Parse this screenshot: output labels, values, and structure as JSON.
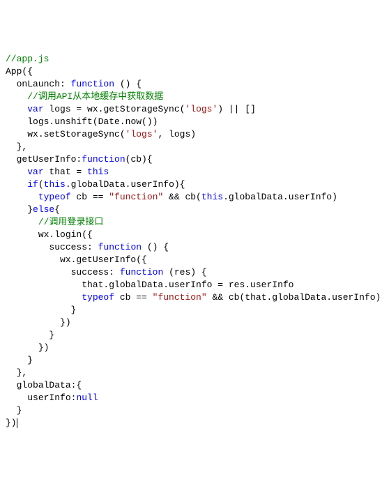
{
  "code": {
    "lines": [
      {
        "indent": 0,
        "tokens": [
          {
            "t": "//app.js",
            "c": "cmt"
          }
        ]
      },
      {
        "indent": 0,
        "tokens": [
          {
            "t": "App({",
            "c": ""
          }
        ]
      },
      {
        "indent": 1,
        "tokens": [
          {
            "t": "onLaunch: ",
            "c": ""
          },
          {
            "t": "function",
            "c": "kw"
          },
          {
            "t": " () {",
            "c": ""
          }
        ]
      },
      {
        "indent": 2,
        "tokens": [
          {
            "t": "//调用API从本地缓存中获取数据",
            "c": "cmt"
          }
        ]
      },
      {
        "indent": 2,
        "tokens": [
          {
            "t": "var",
            "c": "kw"
          },
          {
            "t": " logs = wx.getStorageSync(",
            "c": ""
          },
          {
            "t": "'logs'",
            "c": "str"
          },
          {
            "t": ") || []",
            "c": ""
          }
        ]
      },
      {
        "indent": 2,
        "tokens": [
          {
            "t": "logs.unshift(Date.now())",
            "c": ""
          }
        ]
      },
      {
        "indent": 2,
        "tokens": [
          {
            "t": "wx.setStorageSync(",
            "c": ""
          },
          {
            "t": "'logs'",
            "c": "str"
          },
          {
            "t": ", logs)",
            "c": ""
          }
        ]
      },
      {
        "indent": 1,
        "tokens": [
          {
            "t": "},",
            "c": ""
          }
        ]
      },
      {
        "indent": 1,
        "tokens": [
          {
            "t": "getUserInfo:",
            "c": ""
          },
          {
            "t": "function",
            "c": "kw"
          },
          {
            "t": "(cb){",
            "c": ""
          }
        ]
      },
      {
        "indent": 2,
        "tokens": [
          {
            "t": "var",
            "c": "kw"
          },
          {
            "t": " that = ",
            "c": ""
          },
          {
            "t": "this",
            "c": "ref"
          }
        ]
      },
      {
        "indent": 2,
        "tokens": [
          {
            "t": "if",
            "c": "kw"
          },
          {
            "t": "(",
            "c": ""
          },
          {
            "t": "this",
            "c": "ref"
          },
          {
            "t": ".globalData.userInfo){",
            "c": ""
          }
        ]
      },
      {
        "indent": 3,
        "tokens": [
          {
            "t": "typeof",
            "c": "kw"
          },
          {
            "t": " cb == ",
            "c": ""
          },
          {
            "t": "\"function\"",
            "c": "str"
          },
          {
            "t": " && cb(",
            "c": ""
          },
          {
            "t": "this",
            "c": "ref"
          },
          {
            "t": ".globalData.userInfo)",
            "c": ""
          }
        ]
      },
      {
        "indent": 2,
        "tokens": [
          {
            "t": "}",
            "c": ""
          },
          {
            "t": "else",
            "c": "kw"
          },
          {
            "t": "{",
            "c": ""
          }
        ]
      },
      {
        "indent": 3,
        "tokens": [
          {
            "t": "//调用登录接口",
            "c": "cmt"
          }
        ]
      },
      {
        "indent": 3,
        "tokens": [
          {
            "t": "wx.login({",
            "c": ""
          }
        ]
      },
      {
        "indent": 4,
        "tokens": [
          {
            "t": "success: ",
            "c": ""
          },
          {
            "t": "function",
            "c": "kw"
          },
          {
            "t": " () {",
            "c": ""
          }
        ]
      },
      {
        "indent": 5,
        "tokens": [
          {
            "t": "wx.getUserInfo({",
            "c": ""
          }
        ]
      },
      {
        "indent": 6,
        "tokens": [
          {
            "t": "success: ",
            "c": ""
          },
          {
            "t": "function",
            "c": "kw"
          },
          {
            "t": " (res) {",
            "c": ""
          }
        ]
      },
      {
        "indent": 7,
        "tokens": [
          {
            "t": "that.globalData.userInfo = res.userInfo",
            "c": ""
          }
        ]
      },
      {
        "indent": 7,
        "tokens": [
          {
            "t": "typeof",
            "c": "kw"
          },
          {
            "t": " cb == ",
            "c": ""
          },
          {
            "t": "\"function\"",
            "c": "str"
          },
          {
            "t": " && cb(that.globalData.userInfo)",
            "c": ""
          }
        ]
      },
      {
        "indent": 6,
        "tokens": [
          {
            "t": "}",
            "c": ""
          }
        ]
      },
      {
        "indent": 5,
        "tokens": [
          {
            "t": "})",
            "c": ""
          }
        ]
      },
      {
        "indent": 4,
        "tokens": [
          {
            "t": "}",
            "c": ""
          }
        ]
      },
      {
        "indent": 3,
        "tokens": [
          {
            "t": "})",
            "c": ""
          }
        ]
      },
      {
        "indent": 2,
        "tokens": [
          {
            "t": "}",
            "c": ""
          }
        ]
      },
      {
        "indent": 1,
        "tokens": [
          {
            "t": "},",
            "c": ""
          }
        ]
      },
      {
        "indent": 1,
        "tokens": [
          {
            "t": "globalData:{",
            "c": ""
          }
        ]
      },
      {
        "indent": 2,
        "tokens": [
          {
            "t": "userInfo:",
            "c": ""
          },
          {
            "t": "null",
            "c": "kw"
          }
        ]
      },
      {
        "indent": 1,
        "tokens": [
          {
            "t": "}",
            "c": ""
          }
        ]
      },
      {
        "indent": 0,
        "tokens": [
          {
            "t": "})",
            "c": ""
          }
        ],
        "cursor": true
      }
    ],
    "indentUnit": "  "
  }
}
